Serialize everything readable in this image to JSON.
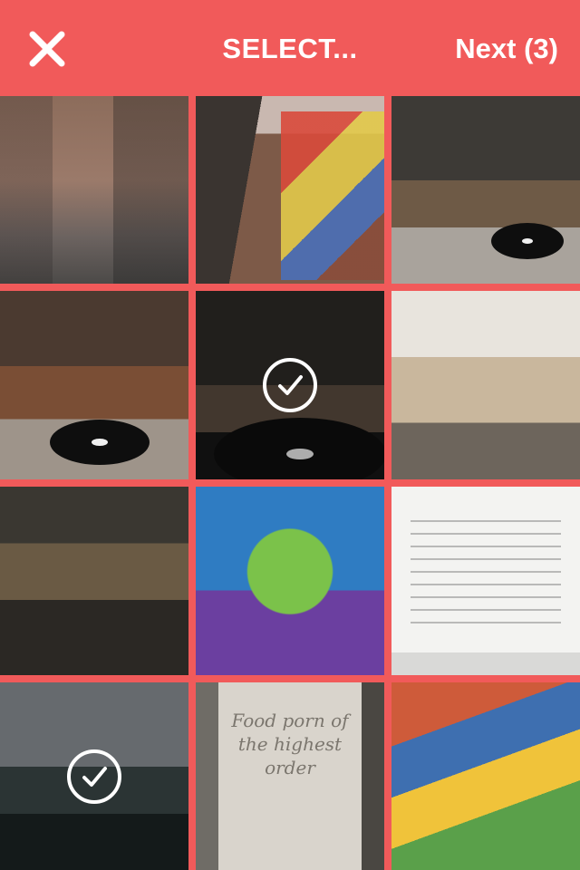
{
  "header": {
    "close_icon": "close-icon",
    "title": "SELECT...",
    "next_label": "Next (3)",
    "background_color": "#f15a5a",
    "text_color": "#ffffff"
  },
  "grid": {
    "tiles": [
      {
        "scene": "alley-brick-graffiti",
        "selected": false
      },
      {
        "scene": "graffiti-lane",
        "selected": false
      },
      {
        "scene": "studio-turntable",
        "selected": false
      },
      {
        "scene": "studio-turntable-room",
        "selected": false
      },
      {
        "scene": "studio-vinyl-closeup",
        "selected": true
      },
      {
        "scene": "millennium-falcon-model",
        "selected": false
      },
      {
        "scene": "arcade-passage",
        "selected": false
      },
      {
        "scene": "frog-graffiti",
        "selected": false
      },
      {
        "scene": "document-screenshot",
        "selected": false
      },
      {
        "scene": "canal-boat",
        "selected": true
      },
      {
        "scene": "food-poster",
        "selected": false
      },
      {
        "scene": "school-mural",
        "selected": false
      }
    ],
    "food_poster_text": "Food porn of the highest order",
    "check_icon": "checkmark-circle-icon"
  }
}
